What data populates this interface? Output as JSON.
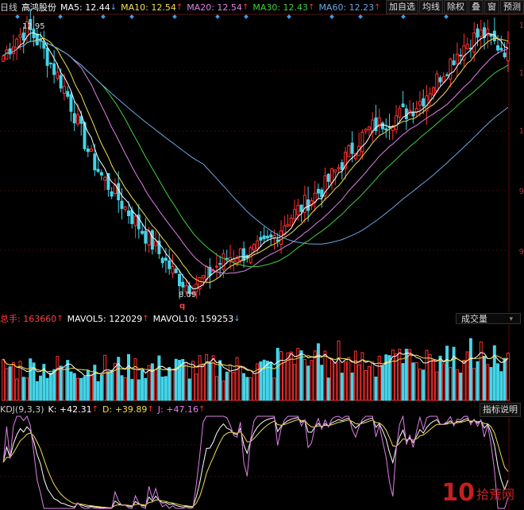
{
  "header": {
    "period": "日线",
    "name": "高鸿股份",
    "ma5": "MA5: 12.44",
    "ma10": "MA10: 12.54",
    "ma20": "MA20: 12.54",
    "ma30": "MA30: 12.43",
    "ma60": "MA60: 12.23"
  },
  "toolbar": [
    "加自选",
    "均线",
    "除权",
    "叠",
    "窗",
    "预测"
  ],
  "price_pane": {
    "high_label": "12.95",
    "low_label": "8.09",
    "q_marker": "q",
    "right_ticks": [
      "1",
      "1",
      "1",
      "9",
      "9"
    ]
  },
  "volume_pane": {
    "total": "总手: 163660",
    "mavol5": "MAVOL5: 122029",
    "mavol10": "MAVOL10: 159253",
    "selector": "成交量"
  },
  "kdj_pane": {
    "title": "KDJ(9,3,3)",
    "k": "K: +42.31",
    "d": "D: +39.89",
    "j": "J: +47.16",
    "help_button": "指标说明"
  },
  "watermark": {
    "big": "10",
    "text": "拾荒网"
  },
  "colors": {
    "up": "#ff3030",
    "down": "#44d4e8",
    "ma5": "#ffffff",
    "ma10": "#f0e04c",
    "ma20": "#e080e8",
    "ma30": "#40d040",
    "ma60": "#6aa6e0"
  },
  "chart_data": {
    "type": "candlestick",
    "close_trend": [
      12.4,
      12.7,
      12.9,
      12.6,
      12.2,
      11.8,
      11.2,
      10.6,
      10.2,
      9.9,
      9.6,
      9.3,
      9.0,
      8.7,
      8.4,
      8.2,
      8.3,
      8.5,
      8.7,
      8.8,
      8.8,
      8.9,
      9.1,
      9.4,
      9.6,
      9.8,
      10.0,
      10.3,
      10.6,
      10.9,
      11.1,
      11.2,
      11.3,
      11.4,
      11.6,
      11.9,
      12.2,
      12.5,
      12.7,
      12.8,
      12.6,
      12.5
    ],
    "price_high": 12.95,
    "price_low": 8.09
  }
}
